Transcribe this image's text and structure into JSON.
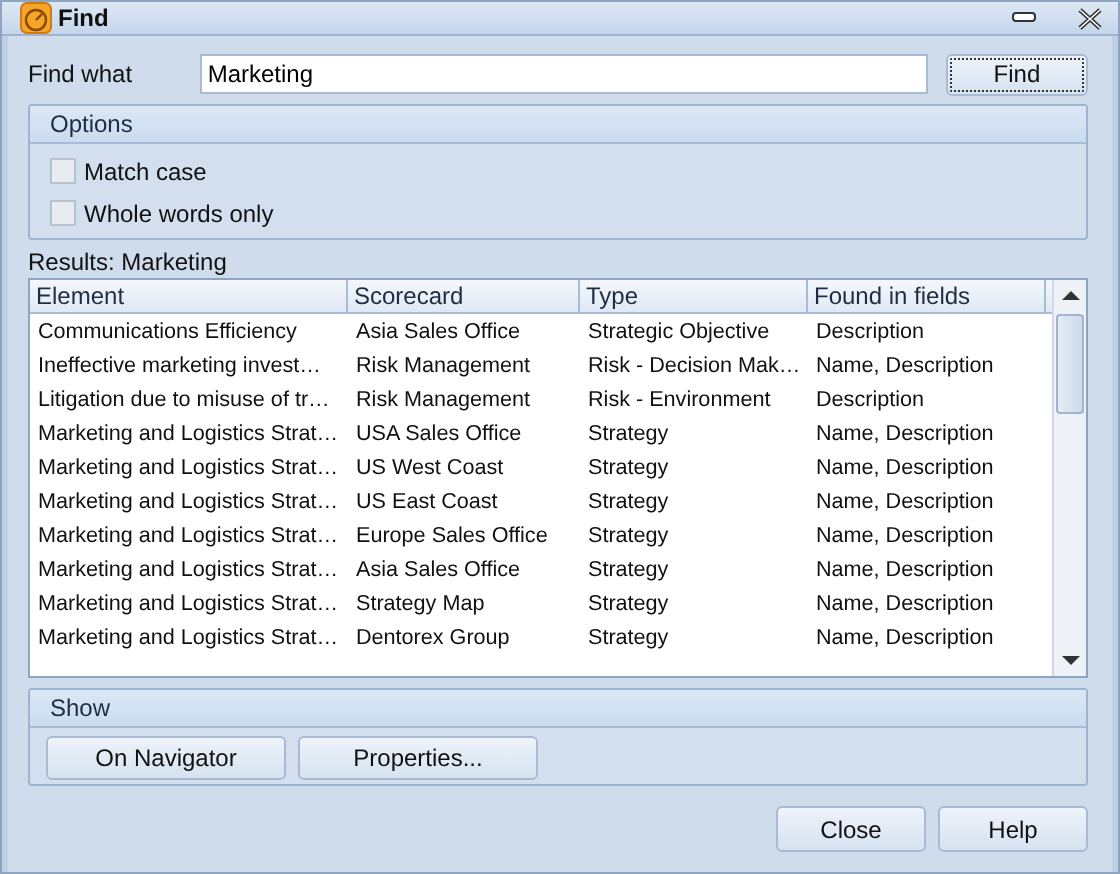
{
  "window": {
    "title": "Find"
  },
  "find": {
    "label": "Find what",
    "value": "Marketing",
    "button": "Find"
  },
  "options": {
    "title": "Options",
    "items": [
      {
        "label": "Match case",
        "checked": false
      },
      {
        "label": "Whole words only",
        "checked": false
      }
    ]
  },
  "results_label": "Results: Marketing",
  "table": {
    "columns": [
      "Element",
      "Scorecard",
      "Type",
      "Found in fields"
    ],
    "rows": [
      [
        "Communications Efficiency",
        "Asia Sales Office",
        "Strategic Objective",
        "Description"
      ],
      [
        "Ineffective marketing invest…",
        "Risk Management",
        "Risk - Decision Mak…",
        "Name, Description"
      ],
      [
        "Litigation due to misuse of tr…",
        "Risk Management",
        "Risk - Environment",
        "Description"
      ],
      [
        "Marketing and Logistics Strat…",
        "USA Sales Office",
        "Strategy",
        "Name, Description"
      ],
      [
        "Marketing and Logistics Strat…",
        "US West Coast",
        "Strategy",
        "Name, Description"
      ],
      [
        "Marketing and Logistics Strat…",
        "US East Coast",
        "Strategy",
        "Name, Description"
      ],
      [
        "Marketing and Logistics Strat…",
        "Europe Sales Office",
        "Strategy",
        "Name, Description"
      ],
      [
        "Marketing and Logistics Strat…",
        "Asia Sales Office",
        "Strategy",
        "Name, Description"
      ],
      [
        "Marketing and Logistics Strat…",
        "Strategy Map",
        "Strategy",
        "Name, Description"
      ],
      [
        "Marketing and Logistics Strat…",
        "Dentorex Group",
        "Strategy",
        "Name, Description"
      ]
    ]
  },
  "show": {
    "title": "Show",
    "buttons": [
      "On Navigator",
      "Properties..."
    ]
  },
  "buttons": [
    "Close",
    "Help"
  ]
}
